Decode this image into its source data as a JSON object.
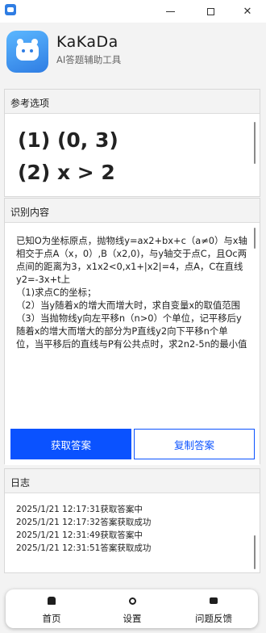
{
  "window": {
    "close_glyph": "✕"
  },
  "app": {
    "title": "KaKaDa",
    "subtitle": "AI答题辅助工具"
  },
  "reference": {
    "header": "参考选项",
    "lines": [
      "(1) (0, 3)",
      "(2) x > 2"
    ]
  },
  "recognition": {
    "header": "识别内容",
    "text": "已知O为坐标原点，抛物线y=ax2+bx+c（a≠0）与x轴相交于点A（x，0）,B（x2,0)，与y轴交于点C，且Oc两\n点间的距离为3，x1x2<0,x1+|x2|=4，点A，C在直线y2=-3x+t上\n（1)求点C的坐标；\n（2）当y随着x的增大而增大时，求自变量x的取值范围\n（3）当抛物线y向左平移n（n>0）个单位，记平移后y随着x的增大而增大的部分为P直线y2向下平移n个单\n位，当平移后的直线与P有公共点时，求2n2-5n的最小值",
    "get_answer_label": "获取答案",
    "copy_answer_label": "复制答案"
  },
  "log": {
    "header": "日志",
    "entries": [
      "2025/1/21 12:17:31获取答案中",
      "2025/1/21 12:17:32答案获取成功",
      "2025/1/21 12:31:49获取答案中",
      "2025/1/21 12:31:51答案获取成功"
    ]
  },
  "nav": {
    "items": [
      {
        "label": "首页",
        "icon": "home-icon"
      },
      {
        "label": "设置",
        "icon": "gear-icon"
      },
      {
        "label": "问题反馈",
        "icon": "feedback-icon"
      }
    ]
  },
  "colors": {
    "accent": "#0a52ff",
    "logo": "#2f7de3"
  }
}
